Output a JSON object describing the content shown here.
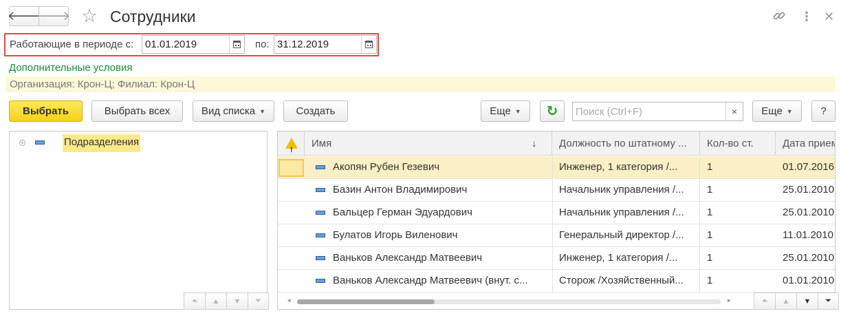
{
  "header": {
    "back_icon": "arrow-left-icon",
    "forward_icon": "arrow-right-icon",
    "favorite_icon": "star-icon",
    "title": "Сотрудники",
    "link_icon": "link-icon",
    "more_icon": "more-vertical-icon",
    "close_icon": "close-icon"
  },
  "period": {
    "from_label": "Работающие в периоде с:",
    "from_value": "01.01.2019",
    "to_label": "по:",
    "to_value": "31.12.2019",
    "highlight_color": "#e04a4a"
  },
  "conditions": {
    "link": "Дополнительные условия",
    "summary": "Организация: Крон-Ц; Филиал: Крон-Ц"
  },
  "toolbar": {
    "select": "Выбрать",
    "select_all": "Выбрать всех",
    "list_view": "Вид списка",
    "create": "Создать",
    "more_left": "Еще",
    "refresh_icon": "refresh-icon",
    "search_placeholder": "Поиск (Ctrl+F)",
    "search_clear": "×",
    "more_right": "Еще",
    "help": "?"
  },
  "tree": {
    "root_label": "Подразделения"
  },
  "table": {
    "columns": [
      "Имя",
      "Должность по штатному ...",
      "Кол-во ст.",
      "Дата прием"
    ],
    "sort_indicator": "↓",
    "rows": [
      {
        "name": "Акопян Рубен Гезевич",
        "position": "Инженер, 1 категория /...",
        "rate": "1",
        "date": "01.07.2016"
      },
      {
        "name": "Базин Антон Владимирович",
        "position": "Начальник управления /...",
        "rate": "1",
        "date": "25.01.2010"
      },
      {
        "name": "Бальцер Герман Эдуардович",
        "position": "Начальник управления /...",
        "rate": "1",
        "date": "25.01.2010"
      },
      {
        "name": "Булатов Игорь Виленович",
        "position": "Генеральный директор /...",
        "rate": "1",
        "date": "11.01.2010"
      },
      {
        "name": "Ваньков Александр Матвеевич",
        "position": "Инженер, 1 категория /...",
        "rate": "1",
        "date": "25.01.2010"
      },
      {
        "name": "Ваньков Александр Матвеевич (внут. с...",
        "position": "Сторож /Хозяйственный...",
        "rate": "1",
        "date": "01.01.2010"
      }
    ]
  },
  "colors": {
    "primary_button": "#f4d21a",
    "selected_row": "#fbf0c5",
    "link_green": "#1a8a3a",
    "conditions_bg": "#fdf9d8"
  }
}
